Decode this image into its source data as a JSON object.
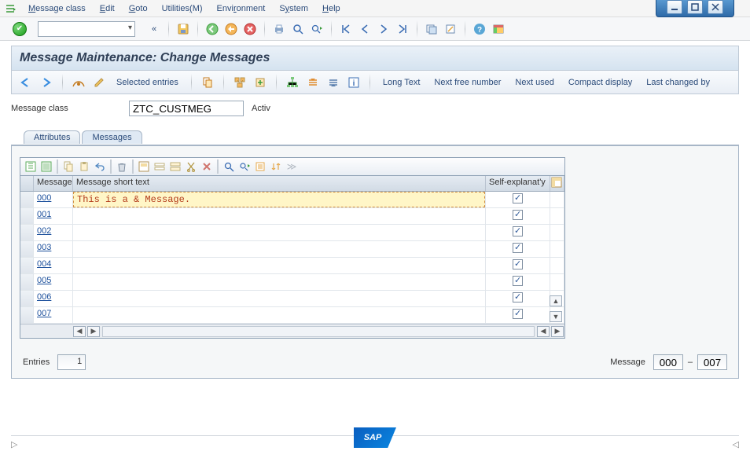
{
  "menu": {
    "items": [
      {
        "label": "Message class",
        "u": 0
      },
      {
        "label": "Edit",
        "u": 0
      },
      {
        "label": "Goto",
        "u": 0
      },
      {
        "label": "Utilities(M)",
        "u": 9
      },
      {
        "label": "Environment",
        "u": 4
      },
      {
        "label": "System",
        "u": 1
      },
      {
        "label": "Help",
        "u": 0
      }
    ]
  },
  "title": "Message Maintenance: Change Messages",
  "toolbar2": {
    "selected_entries": "Selected entries",
    "long_text": "Long Text",
    "next_free": "Next free number",
    "next_used": "Next used",
    "compact": "Compact display",
    "last_changed": "Last changed by"
  },
  "form": {
    "message_class_label": "Message class",
    "message_class_value": "ZTC_CUSTMEG",
    "status": "Activ"
  },
  "tabs": {
    "attributes": "Attributes",
    "messages": "Messages"
  },
  "grid": {
    "headers": {
      "message": "Message",
      "short_text": "Message short text",
      "self_exp": "Self-explanat'y"
    },
    "rows": [
      {
        "id": "000",
        "text": "This is a & Message.",
        "se": true,
        "editing": true
      },
      {
        "id": "001",
        "text": "",
        "se": true
      },
      {
        "id": "002",
        "text": "",
        "se": true
      },
      {
        "id": "003",
        "text": "",
        "se": true
      },
      {
        "id": "004",
        "text": "",
        "se": true
      },
      {
        "id": "005",
        "text": "",
        "se": true
      },
      {
        "id": "006",
        "text": "",
        "se": true
      },
      {
        "id": "007",
        "text": "",
        "se": true
      }
    ]
  },
  "footer": {
    "entries_label": "Entries",
    "entries_value": "1",
    "message_label": "Message",
    "range_from": "000",
    "range_sep": "–",
    "range_to": "007"
  },
  "sap": "SAP"
}
